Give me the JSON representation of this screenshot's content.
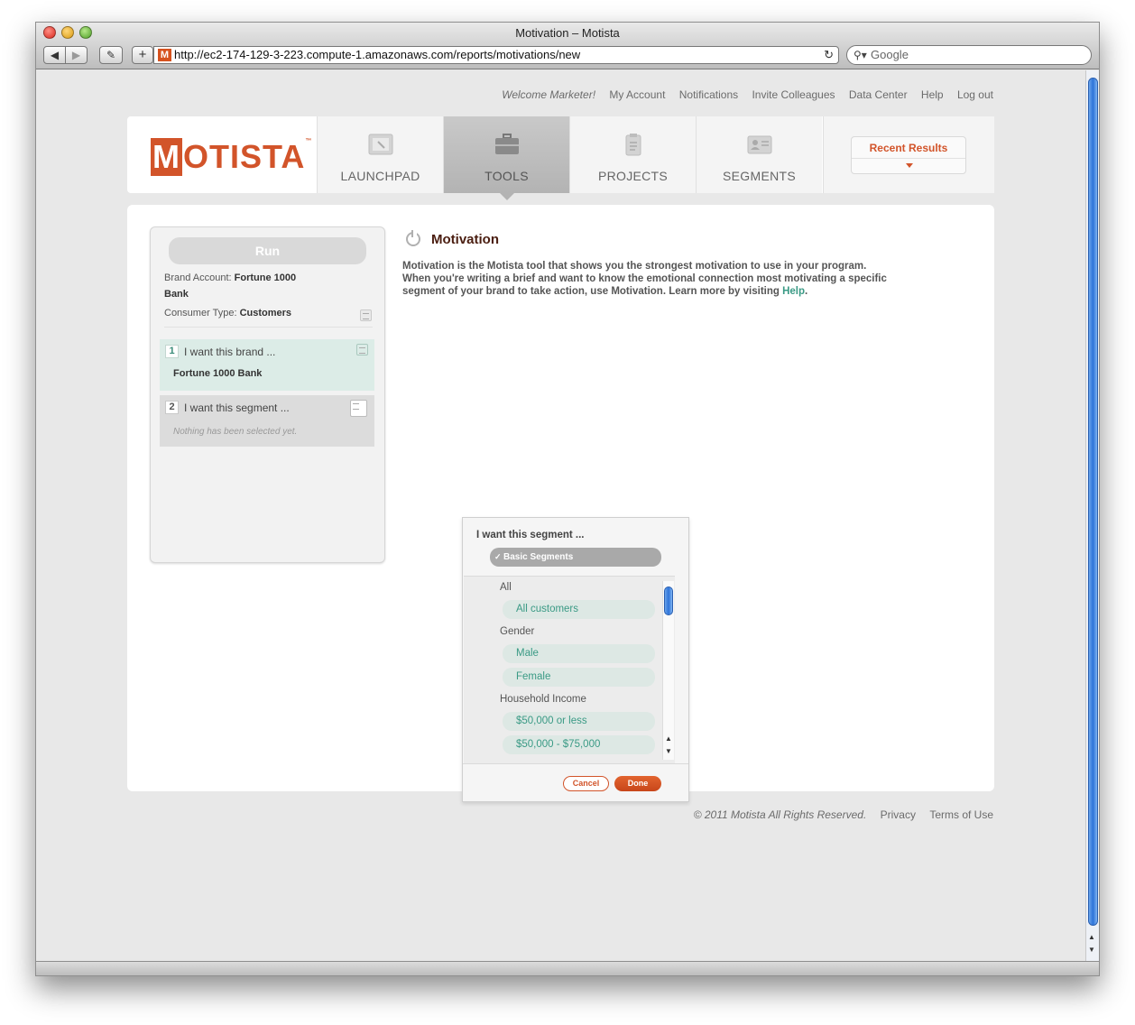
{
  "window": {
    "title": "Motivation – Motista",
    "url": "http://ec2-174-129-3-223.compute-1.amazonaws.com/reports/motivations/new",
    "search_placeholder": "Google"
  },
  "topnav": {
    "welcome": "Welcome Marketer!",
    "links": [
      "My Account",
      "Notifications",
      "Invite Colleagues",
      "Data Center",
      "Help",
      "Log out"
    ]
  },
  "header": {
    "logo_text": "OTISTA",
    "logo_m": "M",
    "logo_tm": "™",
    "tabs": [
      {
        "label": "LAUNCHPAD",
        "icon": "launchpad-icon"
      },
      {
        "label": "TOOLS",
        "icon": "briefcase-icon",
        "active": true
      },
      {
        "label": "PROJECTS",
        "icon": "clipboard-icon"
      },
      {
        "label": "SEGMENTS",
        "icon": "id-card-icon"
      }
    ],
    "recent_results": "Recent Results"
  },
  "left_panel": {
    "run_label": "Run",
    "brand_account_label": "Brand Account:",
    "brand_account_value": "Fortune 1000",
    "brand_account_value2": "Bank",
    "consumer_type_label": "Consumer Type:",
    "consumer_type_value": "Customers",
    "step1": {
      "num": "1",
      "title": "I want this brand ...",
      "value": "Fortune 1000 Bank"
    },
    "step2": {
      "num": "2",
      "title": "I want this segment ...",
      "empty": "Nothing has been selected yet."
    }
  },
  "main": {
    "title": "Motivation",
    "desc_line1": "Motivation is the Motista tool that shows you the strongest motivation to use in your program.",
    "desc_line2": "When you're writing a brief and want to know the emotional connection most motivating a specific",
    "desc_line3": "segment of your brand to take action, use Motivation. Learn more by visiting ",
    "help_link": "Help",
    "desc_end": "."
  },
  "popup": {
    "title": "I want this segment ...",
    "check": "✓",
    "select_value": "Basic Segments",
    "groups": [
      {
        "label": "All",
        "options": [
          "All customers"
        ]
      },
      {
        "label": "Gender",
        "options": [
          "Male",
          "Female"
        ]
      },
      {
        "label": "Household Income",
        "options": [
          "$50,000 or less",
          "$50,000 - $75,000"
        ]
      }
    ],
    "cancel": "Cancel",
    "done": "Done"
  },
  "footer": {
    "copyright": "© 2011 Motista All Rights Reserved.",
    "privacy": "Privacy",
    "terms": "Terms of Use"
  }
}
